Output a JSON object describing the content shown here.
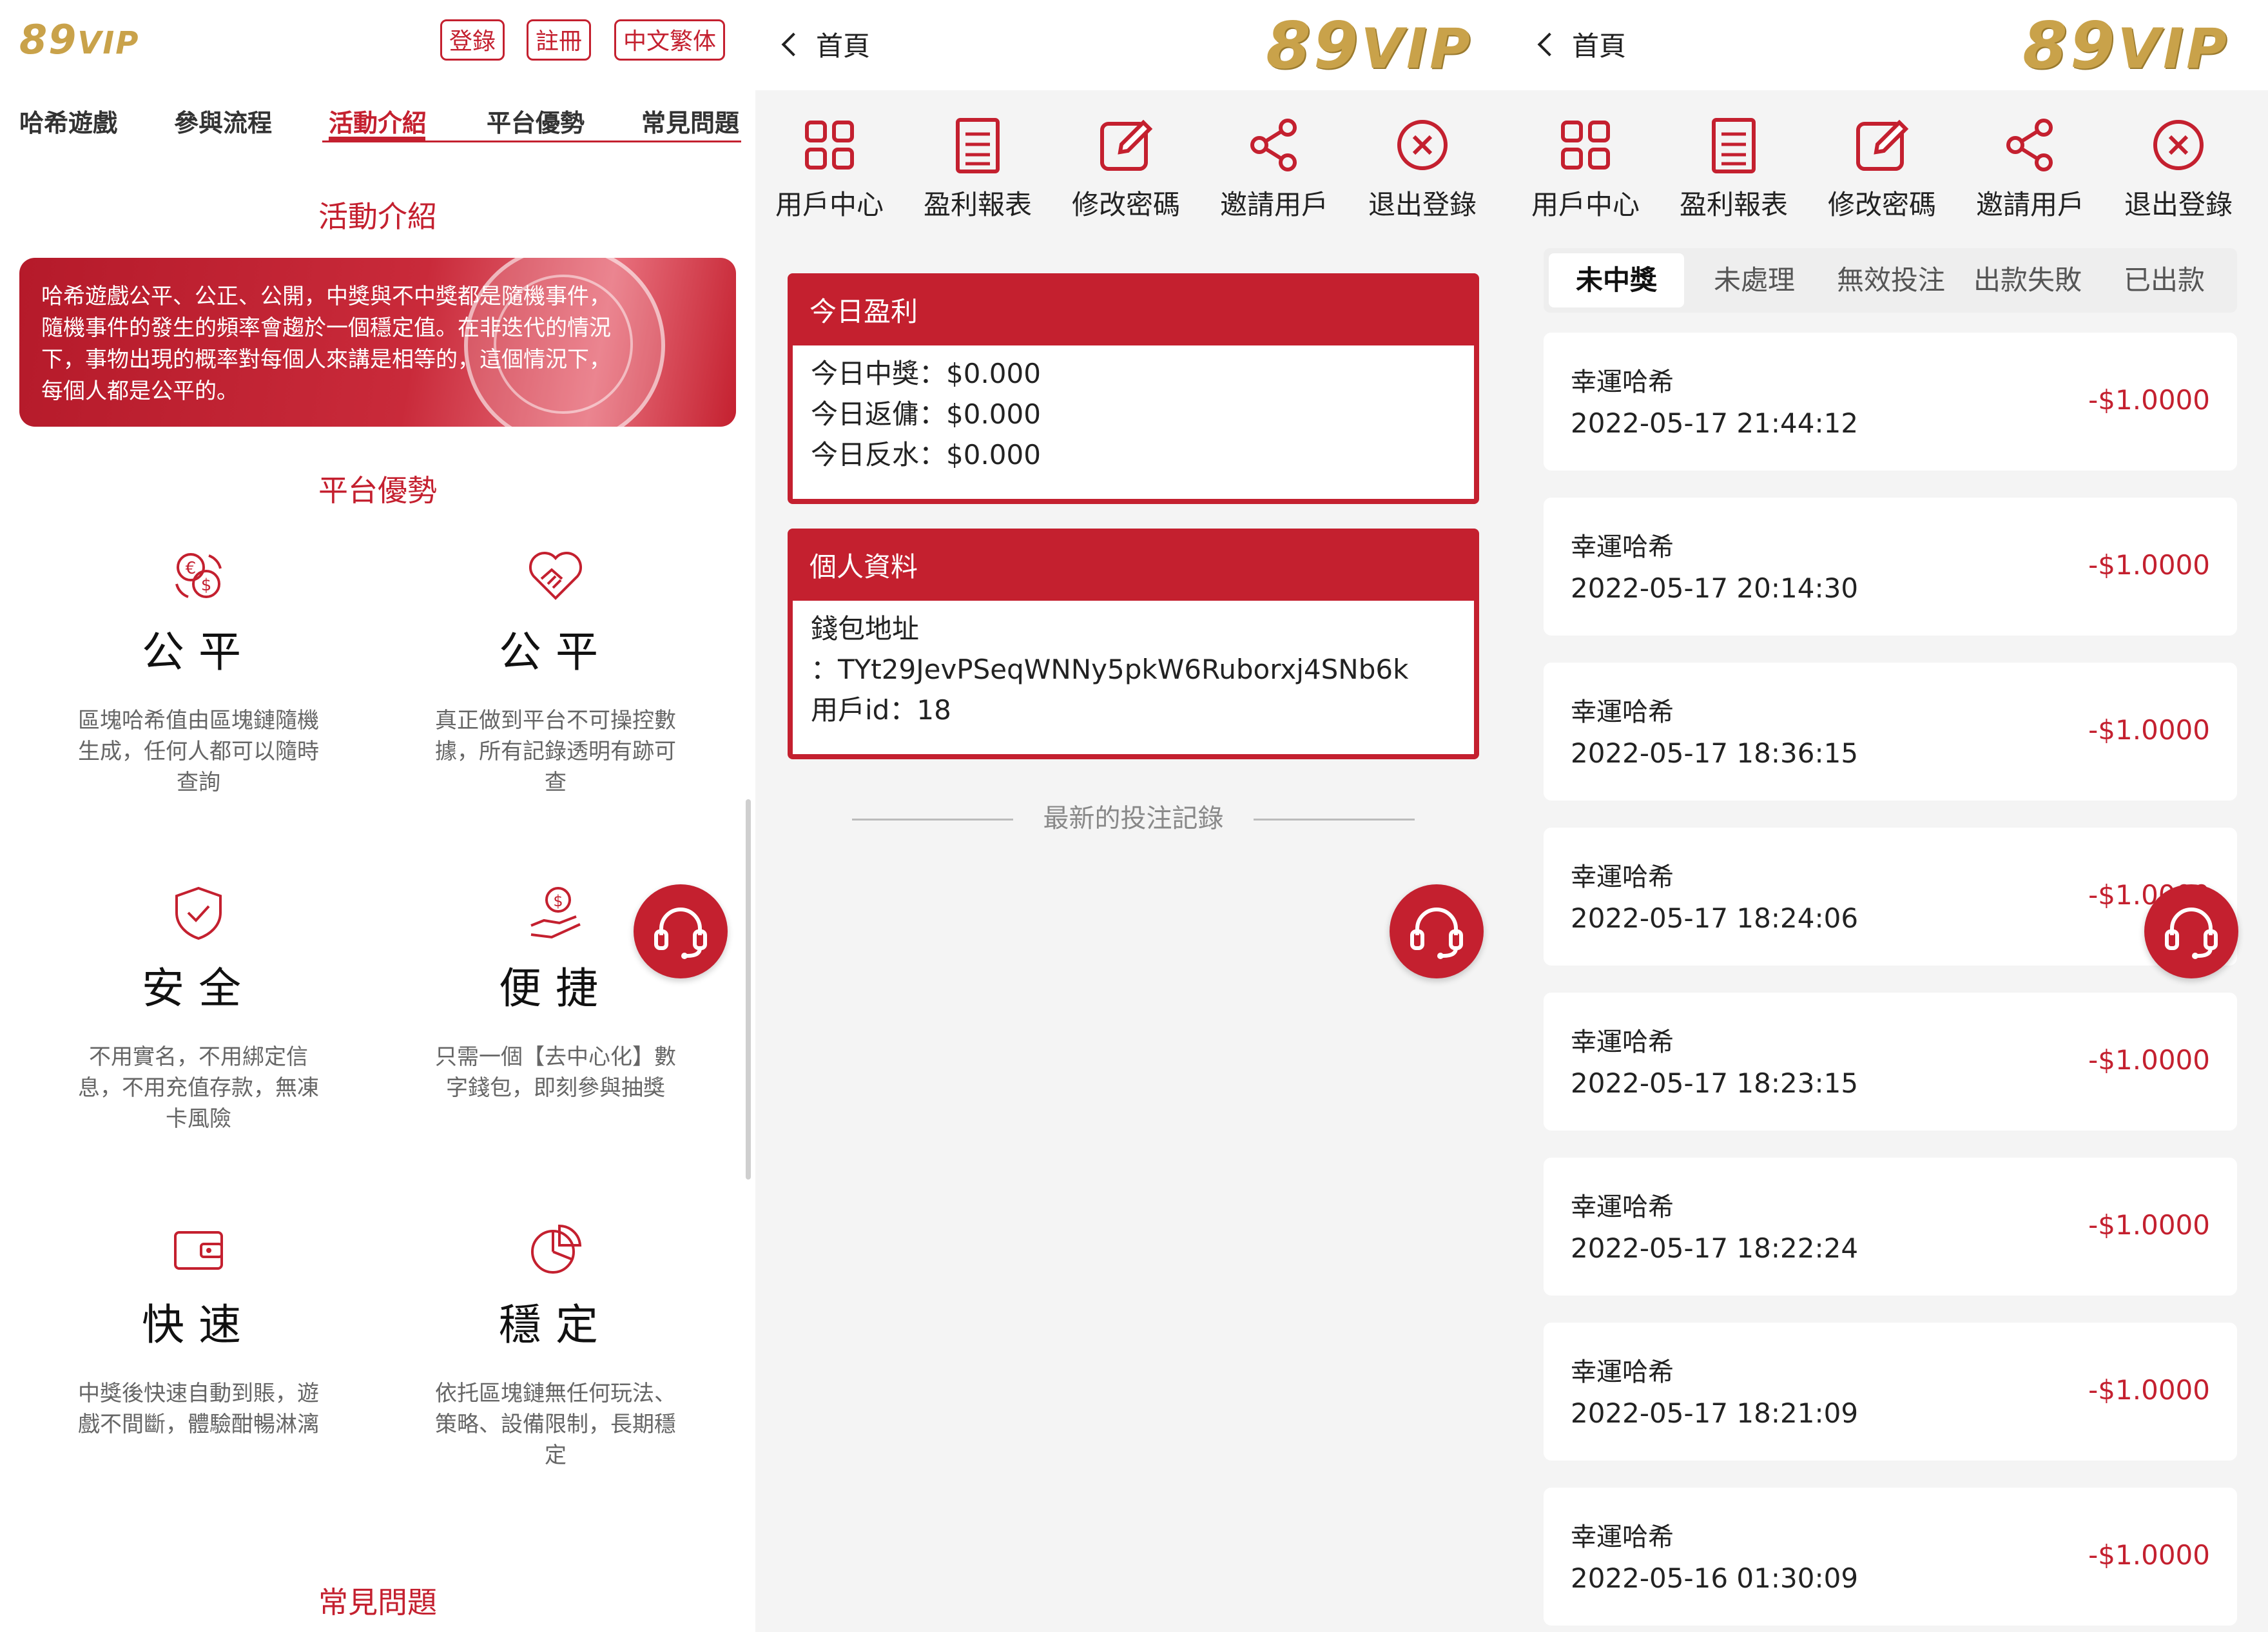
{
  "colors": {
    "accent": "#c4202f",
    "gold": "#c9a24a",
    "background": "#f4f4f4"
  },
  "panel1": {
    "logo": {
      "num": "89",
      "sub": "VIP"
    },
    "header_buttons": [
      "登錄",
      "註冊",
      "中文繁体"
    ],
    "nav": [
      "哈希遊戲",
      "參與流程",
      "活動介紹",
      "平台優勢",
      "常見問題"
    ],
    "nav_active": "活動介紹",
    "section_activity": "活動介紹",
    "banner_text": "哈希遊戲公平、公正、公開，中獎與不中獎都是隨機事件，隨機事件的發生的頻率會趨於一個穩定值。在非迭代的情況下，事物出現的概率對每個人來講是相等的，這個情況下，每個人都是公平的。",
    "section_advantages": "平台優勢",
    "features": [
      {
        "icon": "currency-exchange-icon",
        "title": "公平",
        "desc": "區塊哈希值由區塊鏈隨機生成，任何人都可以隨時查詢"
      },
      {
        "icon": "handshake-heart-icon",
        "title": "公平",
        "desc": "真正做到平台不可操控數據，所有記錄透明有跡可查"
      },
      {
        "icon": "shield-check-icon",
        "title": "安全",
        "desc": "不用實名，不用綁定信息，不用充值存款，無凍卡風險"
      },
      {
        "icon": "hand-coin-icon",
        "title": "便捷",
        "desc": "只需一個【去中心化】數字錢包，即刻參與抽獎"
      },
      {
        "icon": "wallet-icon",
        "title": "快速",
        "desc": "中獎後快速自動到賬，遊戲不間斷，體驗酣暢淋漓"
      },
      {
        "icon": "pie-chart-icon",
        "title": "穩定",
        "desc": "依托區塊鏈無任何玩法、策略、設備限制，長期穩定"
      }
    ],
    "section_faq": "常見問題"
  },
  "panel2": {
    "back_label": "首頁",
    "logo": {
      "num": "89",
      "sub": "VIP"
    },
    "toolbar": [
      {
        "icon": "grid-icon",
        "label": "用戶中心"
      },
      {
        "icon": "report-icon",
        "label": "盈利報表"
      },
      {
        "icon": "edit-icon",
        "label": "修改密碼"
      },
      {
        "icon": "share-icon",
        "label": "邀請用戶"
      },
      {
        "icon": "logout-icon",
        "label": "退出登錄"
      }
    ],
    "profit_card": {
      "title": "今日盈利",
      "rows": [
        {
          "label": "今日中獎：",
          "value": "$0.000"
        },
        {
          "label": "今日返傭：",
          "value": "$0.000"
        },
        {
          "label": "今日反水：",
          "value": "$0.000"
        }
      ]
    },
    "profile_card": {
      "title": "個人資料",
      "wallet_label": "錢包地址",
      "wallet_value": "：TYt29JevPSeqWNNy5pkW6Ruborxj4SNb6k",
      "uid_label": "用戶id：",
      "uid_value": "18"
    },
    "latest_records": "最新的投注記錄"
  },
  "panel3": {
    "back_label": "首頁",
    "logo": {
      "num": "89",
      "sub": "VIP"
    },
    "toolbar": [
      {
        "icon": "grid-icon",
        "label": "用戶中心"
      },
      {
        "icon": "report-icon",
        "label": "盈利報表"
      },
      {
        "icon": "edit-icon",
        "label": "修改密碼"
      },
      {
        "icon": "share-icon",
        "label": "邀請用戶"
      },
      {
        "icon": "logout-icon",
        "label": "退出登錄"
      }
    ],
    "tabs": [
      "未中獎",
      "未處理",
      "無效投注",
      "出款失敗",
      "已出款"
    ],
    "tab_active": "未中獎",
    "records": [
      {
        "title": "幸運哈希",
        "time": "2022-05-17 21:44:12",
        "amount": "-$1.0000"
      },
      {
        "title": "幸運哈希",
        "time": "2022-05-17 20:14:30",
        "amount": "-$1.0000"
      },
      {
        "title": "幸運哈希",
        "time": "2022-05-17 18:36:15",
        "amount": "-$1.0000"
      },
      {
        "title": "幸運哈希",
        "time": "2022-05-17 18:24:06",
        "amount": "-$1.0000"
      },
      {
        "title": "幸運哈希",
        "time": "2022-05-17 18:23:15",
        "amount": "-$1.0000"
      },
      {
        "title": "幸運哈希",
        "time": "2022-05-17 18:22:24",
        "amount": "-$1.0000"
      },
      {
        "title": "幸運哈希",
        "time": "2022-05-17 18:21:09",
        "amount": "-$1.0000"
      },
      {
        "title": "幸運哈希",
        "time": "2022-05-16 01:30:09",
        "amount": "-$1.0000"
      }
    ]
  }
}
